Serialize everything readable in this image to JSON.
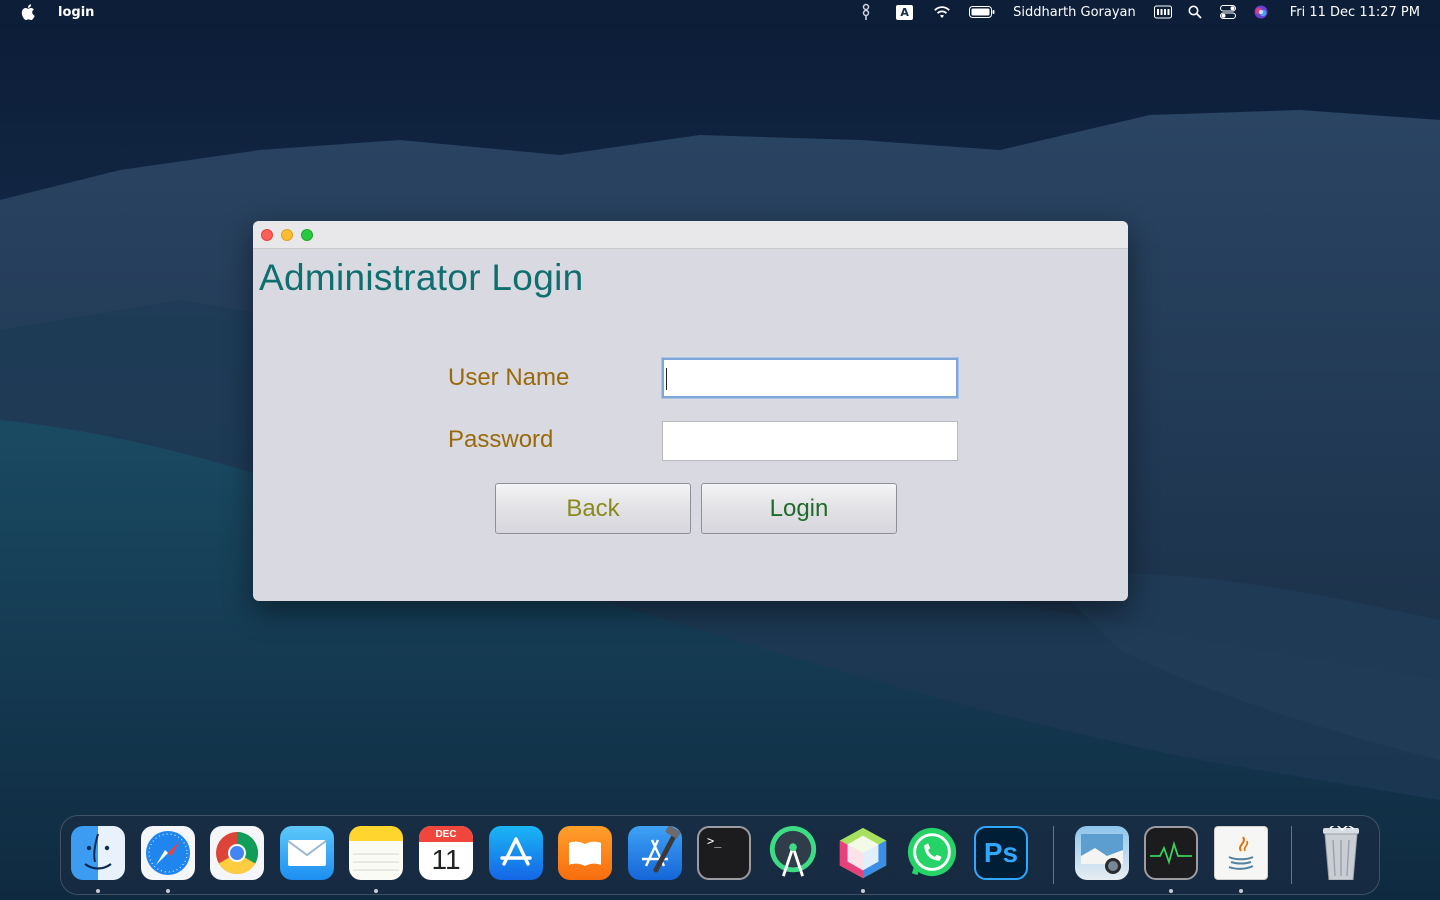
{
  "menubar": {
    "app_name": "login",
    "user_name": "Siddharth Gorayan",
    "clock": "Fri 11 Dec  11:27 PM",
    "input_source": "A",
    "icons": [
      "apple-icon",
      "tag-icon",
      "input-source-icon",
      "wifi-icon",
      "battery-icon",
      "keyboard-viewer-icon",
      "spotlight-icon",
      "control-center-icon",
      "siri-icon"
    ]
  },
  "window": {
    "title": "",
    "heading": "Administrator Login",
    "form": {
      "username_label": "User Name",
      "password_label": "Password",
      "username_value": "",
      "password_value": ""
    },
    "buttons": {
      "back": "Back",
      "login": "Login"
    },
    "colors": {
      "heading": "#0f6f6f",
      "labels": "#9a6a0a",
      "back_text": "#8a8a1c",
      "login_text": "#1f6b2b",
      "background": "#d8d9e1"
    }
  },
  "dock": {
    "items": [
      {
        "name": "Finder",
        "icon": "finder-icon",
        "running": true
      },
      {
        "name": "Safari",
        "icon": "safari-icon",
        "running": true
      },
      {
        "name": "Google Chrome",
        "icon": "chrome-icon",
        "running": false
      },
      {
        "name": "Mail",
        "icon": "mail-icon",
        "running": false
      },
      {
        "name": "Notes",
        "icon": "notes-icon",
        "running": true
      },
      {
        "name": "Calendar",
        "icon": "calendar-icon",
        "running": false,
        "month": "DEC",
        "day": "11"
      },
      {
        "name": "App Store",
        "icon": "app-store-icon",
        "running": false
      },
      {
        "name": "Books",
        "icon": "books-icon",
        "running": false
      },
      {
        "name": "Xcode",
        "icon": "xcode-icon",
        "running": false
      },
      {
        "name": "Terminal",
        "icon": "terminal-icon",
        "running": false
      },
      {
        "name": "Android Studio",
        "icon": "android-studio-icon",
        "running": false
      },
      {
        "name": "NetBeans",
        "icon": "netbeans-icon",
        "running": true
      },
      {
        "name": "WhatsApp",
        "icon": "whatsapp-icon",
        "running": false
      },
      {
        "name": "Photoshop",
        "icon": "photoshop-icon",
        "running": false,
        "text": "Ps"
      },
      {
        "name": "Preview",
        "icon": "preview-icon",
        "running": false
      },
      {
        "name": "Activity Monitor",
        "icon": "activity-monitor-icon",
        "running": true
      },
      {
        "name": "Java",
        "icon": "java-icon",
        "running": true
      },
      {
        "name": "Trash",
        "icon": "trash-icon",
        "running": false
      }
    ]
  }
}
